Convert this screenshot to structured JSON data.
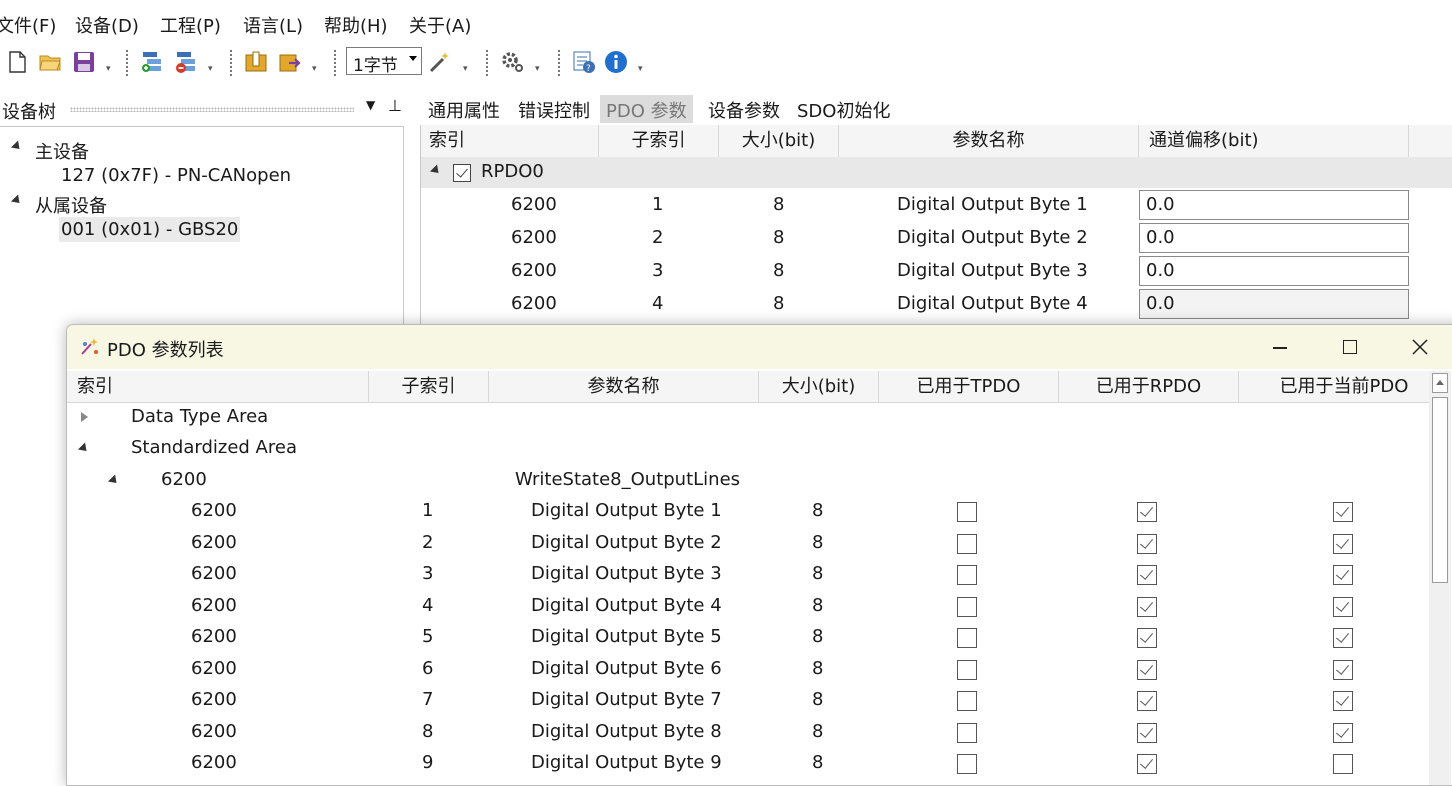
{
  "menu": [
    "文件(F)",
    "设备(D)",
    "工程(P)",
    "语言(L)",
    "帮助(H)",
    "关于(A)"
  ],
  "toolbar": {
    "icons": [
      "new-file-icon",
      "open-folder-icon",
      "save-icon",
      "add-device-icon",
      "remove-device-icon",
      "upload-icon",
      "download-icon",
      "wand-icon",
      "gear-icon",
      "help-icon",
      "info-icon"
    ],
    "combo_value": "1字节"
  },
  "left_panel": {
    "title": "设备树",
    "tree": [
      {
        "label": "主设备",
        "level": 0,
        "expanded": true
      },
      {
        "label": "127 (0x7F)  -  PN-CANopen",
        "level": 1
      },
      {
        "label": "从属设备",
        "level": 0,
        "expanded": true
      },
      {
        "label": "001 (0x01)  -  GBS20",
        "level": 1,
        "selected": true
      }
    ]
  },
  "tabs": [
    "通用属性",
    "错误控制",
    "PDO 参数",
    "设备参数",
    "SDO初始化"
  ],
  "active_tab": "PDO 参数",
  "pdo_grid": {
    "columns": [
      "索引",
      "子索引",
      "大小(bit)",
      "参数名称",
      "通道偏移(bit)"
    ],
    "group": {
      "label": "RPDO0",
      "checked": true
    },
    "rows": [
      {
        "index": "6200",
        "sub": "1",
        "size": "8",
        "name": "Digital Output Byte 1",
        "offset": "0.0"
      },
      {
        "index": "6200",
        "sub": "2",
        "size": "8",
        "name": "Digital Output Byte 2",
        "offset": "0.0"
      },
      {
        "index": "6200",
        "sub": "3",
        "size": "8",
        "name": "Digital Output Byte 3",
        "offset": "0.0"
      },
      {
        "index": "6200",
        "sub": "4",
        "size": "8",
        "name": "Digital Output Byte 4",
        "offset": "0.0"
      }
    ]
  },
  "dialog": {
    "title": "PDO 参数列表",
    "columns": [
      "索引",
      "子索引",
      "参数名称",
      "大小(bit)",
      "已用于TPDO",
      "已用于RPDO",
      "已用于当前PDO"
    ],
    "tree_rows": [
      {
        "label": "Data Type Area",
        "expanded": false
      },
      {
        "label": "Standardized Area",
        "expanded": true
      },
      {
        "label": "6200",
        "name": "WriteState8_OutputLines",
        "expanded": true
      }
    ],
    "rows": [
      {
        "index": "6200",
        "sub": "1",
        "name": "Digital Output Byte 1",
        "size": "8",
        "tpdo": false,
        "rpdo": true,
        "current": true
      },
      {
        "index": "6200",
        "sub": "2",
        "name": "Digital Output Byte 2",
        "size": "8",
        "tpdo": false,
        "rpdo": true,
        "current": true
      },
      {
        "index": "6200",
        "sub": "3",
        "name": "Digital Output Byte 3",
        "size": "8",
        "tpdo": false,
        "rpdo": true,
        "current": true
      },
      {
        "index": "6200",
        "sub": "4",
        "name": "Digital Output Byte 4",
        "size": "8",
        "tpdo": false,
        "rpdo": true,
        "current": true
      },
      {
        "index": "6200",
        "sub": "5",
        "name": "Digital Output Byte 5",
        "size": "8",
        "tpdo": false,
        "rpdo": true,
        "current": true
      },
      {
        "index": "6200",
        "sub": "6",
        "name": "Digital Output Byte 6",
        "size": "8",
        "tpdo": false,
        "rpdo": true,
        "current": true
      },
      {
        "index": "6200",
        "sub": "7",
        "name": "Digital Output Byte 7",
        "size": "8",
        "tpdo": false,
        "rpdo": true,
        "current": true
      },
      {
        "index": "6200",
        "sub": "8",
        "name": "Digital Output Byte 8",
        "size": "8",
        "tpdo": false,
        "rpdo": true,
        "current": true
      },
      {
        "index": "6200",
        "sub": "9",
        "name": "Digital Output Byte 9",
        "size": "8",
        "tpdo": false,
        "rpdo": true,
        "current": false
      }
    ]
  }
}
